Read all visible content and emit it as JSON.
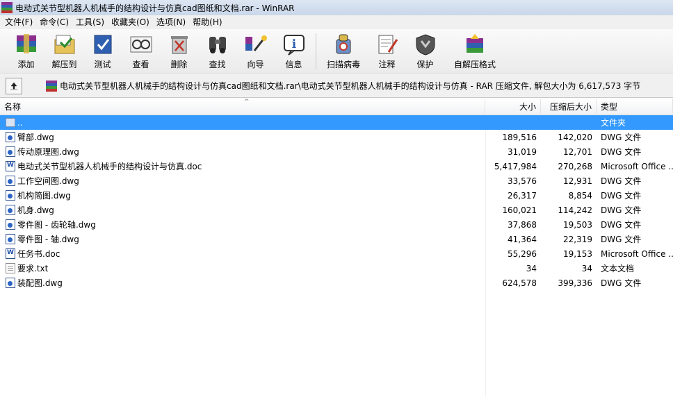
{
  "window": {
    "title": "电动式关节型机器人机械手的结构设计与仿真cad图纸和文档.rar - WinRAR"
  },
  "menu": [
    "文件(F)",
    "命令(C)",
    "工具(S)",
    "收藏夹(O)",
    "选项(N)",
    "帮助(H)"
  ],
  "toolbar": {
    "buttons": [
      {
        "label": "添加",
        "icon": "add-archive-icon"
      },
      {
        "label": "解压到",
        "icon": "extract-to-icon"
      },
      {
        "label": "测试",
        "icon": "test-icon"
      },
      {
        "label": "查看",
        "icon": "view-icon"
      },
      {
        "label": "删除",
        "icon": "delete-icon"
      },
      {
        "label": "查找",
        "icon": "find-icon"
      },
      {
        "label": "向导",
        "icon": "wizard-icon"
      },
      {
        "label": "信息",
        "icon": "info-icon"
      },
      {
        "label": "扫描病毒",
        "icon": "virus-scan-icon"
      },
      {
        "label": "注释",
        "icon": "comment-icon"
      },
      {
        "label": "保护",
        "icon": "protect-icon"
      },
      {
        "label": "自解压格式",
        "icon": "sfx-icon"
      }
    ]
  },
  "address": {
    "text": "电动式关节型机器人机械手的结构设计与仿真cad图纸和文档.rar\\电动式关节型机器人机械手的结构设计与仿真 - RAR 压缩文件, 解包大小为 6,617,573 字节"
  },
  "columns": {
    "name": "名称",
    "size": "大小",
    "packed": "压缩后大小",
    "type": "类型"
  },
  "files": [
    {
      "name": "..",
      "size": "",
      "packed": "",
      "type": "文件夹",
      "icon": "folder"
    },
    {
      "name": "臂部.dwg",
      "size": "189,516",
      "packed": "142,020",
      "type": "DWG 文件",
      "icon": "dwg"
    },
    {
      "name": "传动原理图.dwg",
      "size": "31,019",
      "packed": "12,701",
      "type": "DWG 文件",
      "icon": "dwg"
    },
    {
      "name": "电动式关节型机器人机械手的结构设计与仿真.doc",
      "size": "5,417,984",
      "packed": "270,268",
      "type": "Microsoft Office ...",
      "icon": "doc"
    },
    {
      "name": "工作空间图.dwg",
      "size": "33,576",
      "packed": "12,931",
      "type": "DWG 文件",
      "icon": "dwg"
    },
    {
      "name": "机构简图.dwg",
      "size": "26,317",
      "packed": "8,854",
      "type": "DWG 文件",
      "icon": "dwg"
    },
    {
      "name": "机身.dwg",
      "size": "160,021",
      "packed": "114,242",
      "type": "DWG 文件",
      "icon": "dwg"
    },
    {
      "name": "零件图 - 齿轮轴.dwg",
      "size": "37,868",
      "packed": "19,503",
      "type": "DWG 文件",
      "icon": "dwg"
    },
    {
      "name": "零件图 - 轴.dwg",
      "size": "41,364",
      "packed": "22,319",
      "type": "DWG 文件",
      "icon": "dwg"
    },
    {
      "name": "任务书.doc",
      "size": "55,296",
      "packed": "19,153",
      "type": "Microsoft Office ...",
      "icon": "doc"
    },
    {
      "name": "要求.txt",
      "size": "34",
      "packed": "34",
      "type": "文本文档",
      "icon": "txt"
    },
    {
      "name": "装配图.dwg",
      "size": "624,578",
      "packed": "399,336",
      "type": "DWG 文件",
      "icon": "dwg"
    }
  ],
  "selected_index": 0,
  "colors": {
    "selection": "#3399ff",
    "titlebar": "#c9d7ea"
  }
}
